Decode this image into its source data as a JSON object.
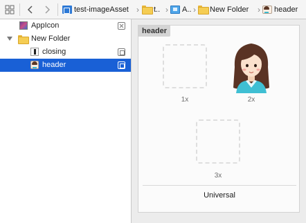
{
  "jump_bar": {
    "crumbs": [
      "test-imageAsset",
      "t..",
      "A..",
      "New Folder",
      "header"
    ]
  },
  "sidebar": {
    "items": [
      {
        "label": "AppIcon"
      },
      {
        "label": "New Folder"
      },
      {
        "label": "closing"
      },
      {
        "label": "header"
      }
    ]
  },
  "asset": {
    "title": "header",
    "slots": [
      "1x",
      "2x",
      "3x"
    ],
    "device": "Universal"
  },
  "colors": {
    "selection": "#1960d6",
    "folder": "#f5cd53"
  }
}
